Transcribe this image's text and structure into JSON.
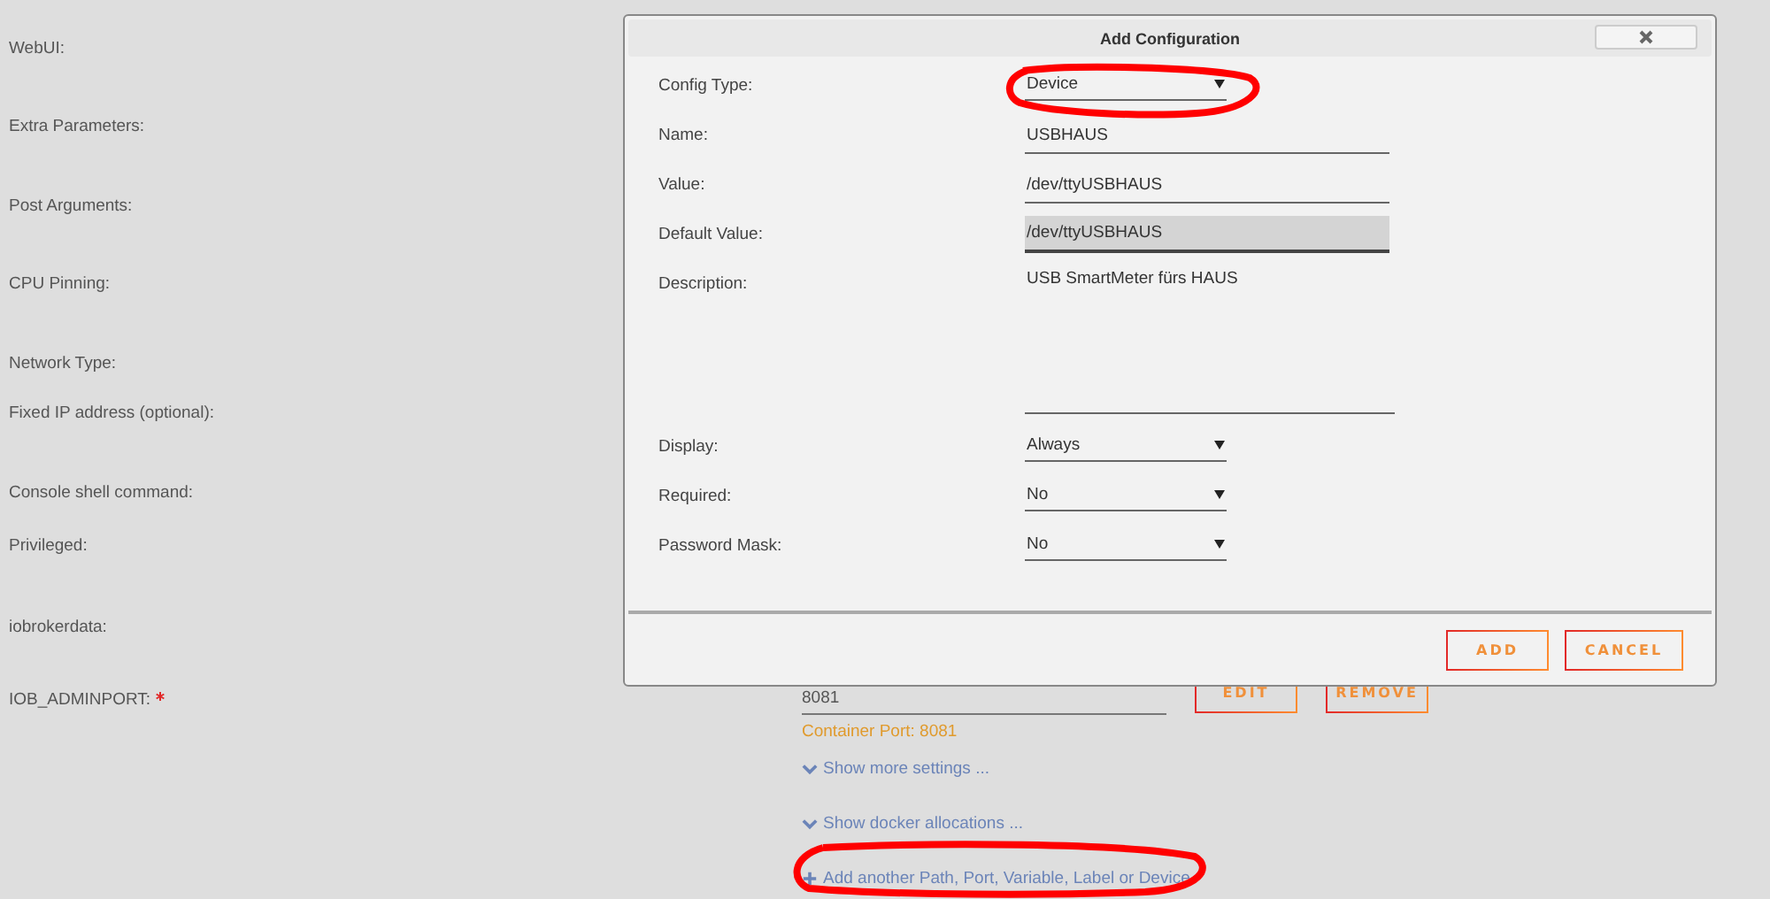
{
  "background_form": {
    "labels": [
      {
        "text": "WebUI:",
        "required": false
      },
      {
        "text": "Extra Parameters:",
        "required": false
      },
      {
        "text": "Post Arguments:",
        "required": false
      },
      {
        "text": "CPU Pinning:",
        "required": false
      },
      {
        "text": "Network Type:",
        "required": false
      },
      {
        "text": "Fixed IP address (optional):",
        "required": false
      },
      {
        "text": "Console shell command:",
        "required": false
      },
      {
        "text": "Privileged:",
        "required": false
      },
      {
        "text": "iobrokerdata:",
        "required": false
      },
      {
        "text": "IOB_ADMINPORT:",
        "required": true
      }
    ],
    "port_field": {
      "value": "8081",
      "hint": "Container Port: 8081"
    },
    "buttons": [
      "EDIT",
      "REMOVE"
    ],
    "links": [
      {
        "kind": "toggle",
        "label": "Show more settings ..."
      },
      {
        "kind": "toggle",
        "label": "Show docker allocations ..."
      },
      {
        "kind": "add",
        "label": "Add another Path, Port, Variable, Label or Device"
      }
    ]
  },
  "dialog": {
    "title": "Add Configuration",
    "fields": [
      {
        "kind": "select",
        "label": "Config Type:",
        "value": "Device"
      },
      {
        "kind": "text",
        "label": "Name:",
        "value": "USBHAUS",
        "focused": false
      },
      {
        "kind": "text",
        "label": "Value:",
        "value": "/dev/ttyUSBHAUS",
        "focused": false
      },
      {
        "kind": "text",
        "label": "Default Value:",
        "value": "/dev/ttyUSBHAUS",
        "focused": true
      },
      {
        "kind": "textarea",
        "label": "Description:",
        "value": "USB SmartMeter fürs HAUS"
      },
      {
        "kind": "select",
        "label": "Display:",
        "value": "Always"
      },
      {
        "kind": "select",
        "label": "Required:",
        "value": "No"
      },
      {
        "kind": "select",
        "label": "Password Mask:",
        "value": "No"
      }
    ],
    "buttons": [
      "ADD",
      "CANCEL"
    ]
  }
}
